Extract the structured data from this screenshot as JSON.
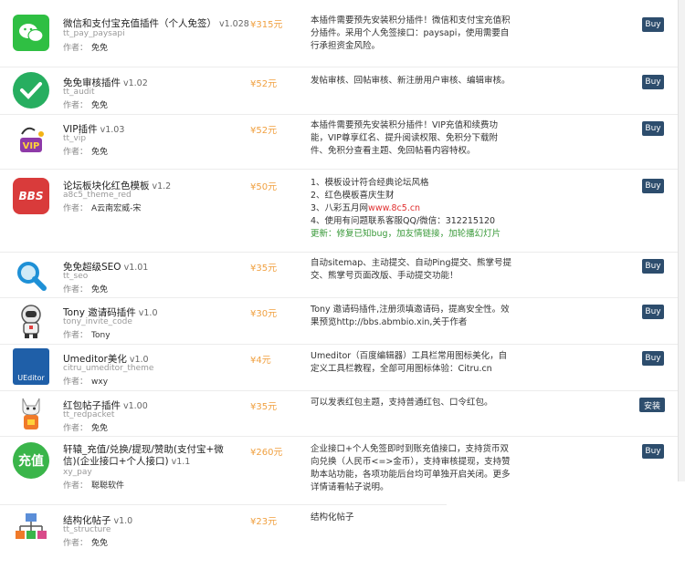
{
  "author_label": "作者：",
  "plugins": [
    {
      "name": "微信和支付宝充值插件（个人免签）",
      "version": "v1.028",
      "id": "tt_pay_paysapi",
      "author": "免免",
      "price": "¥315元",
      "desc": [
        "本插件需要预先安装积分插件！微信和支付宝充值积",
        "分插件。采用个人免签接口：paysapi，使用需要自",
        "行承担资金风险。"
      ],
      "button": "Buy",
      "icon": "wechat-icon"
    },
    {
      "name": "免免审核插件",
      "version": "v1.02",
      "id": "tt_audit",
      "author": "免免",
      "price": "¥52元",
      "desc": [
        "发帖审核、回帖审核、新注册用户审核、编辑审核。"
      ],
      "button": "Buy",
      "icon": "check-icon"
    },
    {
      "name": "VIP插件",
      "version": "v1.03",
      "id": "tt_vip",
      "author": "免免",
      "price": "¥52元",
      "desc": [
        "本插件需要预先安装积分插件！VIP充值和续费功",
        "能，VIP尊享红名、提升阅读权限、免积分下载附",
        "件、免积分查看主题、免回帖看内容特权。"
      ],
      "button": "Buy",
      "icon": "vip-icon"
    },
    {
      "name": "论坛板块化红色模板",
      "version": "v1.2",
      "id": "a8c5_theme_red",
      "author": "A云南宏威-宋",
      "price": "¥50元",
      "desc": [
        "1、模板设计符合经典论坛风格",
        "2、红色模板喜庆生财",
        "3、八彩五月网",
        "4、使用有问题联系客服QQ/微信：312215120",
        "更新：修复已知bug，加友情链接，加轮播幻灯片"
      ],
      "desc_highlight": "www.8c5.cn",
      "button": "Buy",
      "icon": "bbs-icon",
      "icon_text": "BBS"
    },
    {
      "name": "免免超级SEO",
      "version": "v1.01",
      "id": "tt_seo",
      "author": "免免",
      "price": "¥35元",
      "desc": [
        "自动sitemap、主动提交、自动Ping提交、熊掌号提",
        "交、熊掌号页面改版、手动提交功能！"
      ],
      "button": "Buy",
      "icon": "magnifier-icon"
    },
    {
      "name": "Tony 邀请码插件",
      "version": "v1.0",
      "id": "tony_invite_code",
      "author": "Tony",
      "price": "¥30元",
      "desc": [
        "Tony 邀请码插件,注册须填邀请码，提高安全性。效",
        "果预览http://bbs.abmbio.xin,关于作者"
      ],
      "button": "Buy",
      "icon": "astronaut-icon"
    },
    {
      "name": "Umeditor美化",
      "version": "v1.0",
      "id": "citru_umeditor_theme",
      "author": "wxy",
      "price": "¥4元",
      "desc": [
        "Umeditor（百度编辑器）工具栏常用图标美化，自",
        "定义工具栏教程，全部可用图标体验：Citru.cn"
      ],
      "button": "Buy",
      "icon": "ueditor-icon",
      "icon_text": "UEditor"
    },
    {
      "name": "红包帖子插件",
      "version": "v1.00",
      "id": "tt_redpacket",
      "author": "免免",
      "price": "¥35元",
      "desc": [
        "可以发表红包主题，支持普通红包、口令红包。"
      ],
      "button": "安装",
      "icon": "cat-icon"
    },
    {
      "name": "轩辕_充值/兑换/提现/赞助(支付宝+微信)(企业接口+个人接口)",
      "version": "v1.1",
      "id": "xy_pay",
      "author": "聪聪软件",
      "price": "¥260元",
      "desc": [
        "企业接口+个人免签即时到账充值接口，支持货币双",
        "向兑换（人民币<=>金币），支持审核提现，支持赞",
        "助本站功能，各项功能后台均可单独开启关闭。更多",
        "详情请看帖子说明。"
      ],
      "button": "Buy",
      "icon": "recharge-icon",
      "icon_text": "充值"
    },
    {
      "name": "结构化帖子",
      "version": "v1.0",
      "id": "tt_structure",
      "author": "免免",
      "price": "¥23元",
      "desc": [
        "结构化帖子"
      ],
      "button": "",
      "icon": "structure-icon"
    }
  ]
}
